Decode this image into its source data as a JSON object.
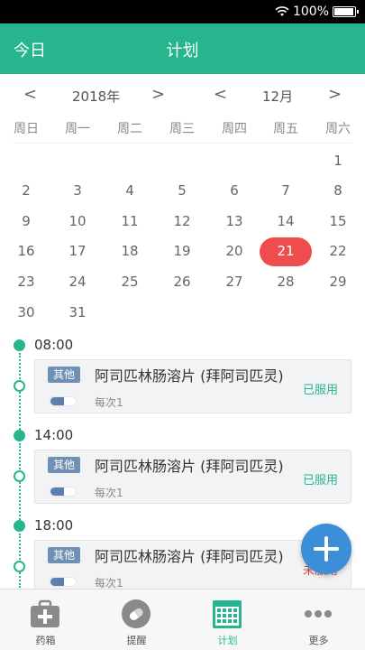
{
  "statusbar": {
    "battery": "100%",
    "battery_level": 1.0,
    "wifi_icon": "wifi-icon"
  },
  "header": {
    "today_label": "今日",
    "title": "计划"
  },
  "pickers": {
    "year": "2018年",
    "month": "12月",
    "prev_symbol": "<",
    "next_symbol": ">"
  },
  "weekdays": [
    "周日",
    "周一",
    "周二",
    "周三",
    "周四",
    "周五",
    "周六"
  ],
  "calendar": {
    "weeks": [
      [
        "",
        "",
        "",
        "",
        "",
        "",
        "1"
      ],
      [
        "2",
        "3",
        "4",
        "5",
        "6",
        "7",
        "8"
      ],
      [
        "9",
        "10",
        "11",
        "12",
        "13",
        "14",
        "15"
      ],
      [
        "16",
        "17",
        "18",
        "19",
        "20",
        "21",
        "22"
      ],
      [
        "23",
        "24",
        "25",
        "26",
        "27",
        "28",
        "29"
      ],
      [
        "30",
        "31",
        "",
        "",
        "",
        "",
        ""
      ]
    ],
    "selected_day": "21",
    "selected_color": "#ef4d4d"
  },
  "schedule": [
    {
      "time": "08:00",
      "tag": "其他",
      "name": "阿司匹林肠溶片 (拜阿司匹灵)",
      "dose": "每次1",
      "status": "已服用"
    },
    {
      "time": "14:00",
      "tag": "其他",
      "name": "阿司匹林肠溶片 (拜阿司匹灵)",
      "dose": "每次1",
      "status": "已服用"
    },
    {
      "time": "18:00",
      "tag": "其他",
      "name": "阿司匹林肠溶片 (拜阿司匹灵)",
      "dose": "每次1",
      "status": "未服用"
    }
  ],
  "fab": {
    "icon": "plus-icon"
  },
  "nav": [
    {
      "label": "药箱",
      "icon": "medicine-box-icon"
    },
    {
      "label": "提醒",
      "icon": "pill-bell-icon"
    },
    {
      "label": "计划",
      "icon": "calendar-icon",
      "active": true
    },
    {
      "label": "更多",
      "icon": "more-dots-icon"
    }
  ],
  "colors": {
    "accent": "#27b58e",
    "tag": "#6f8fb4",
    "fab": "#3d8ed8",
    "pending": "#e24a4a"
  }
}
